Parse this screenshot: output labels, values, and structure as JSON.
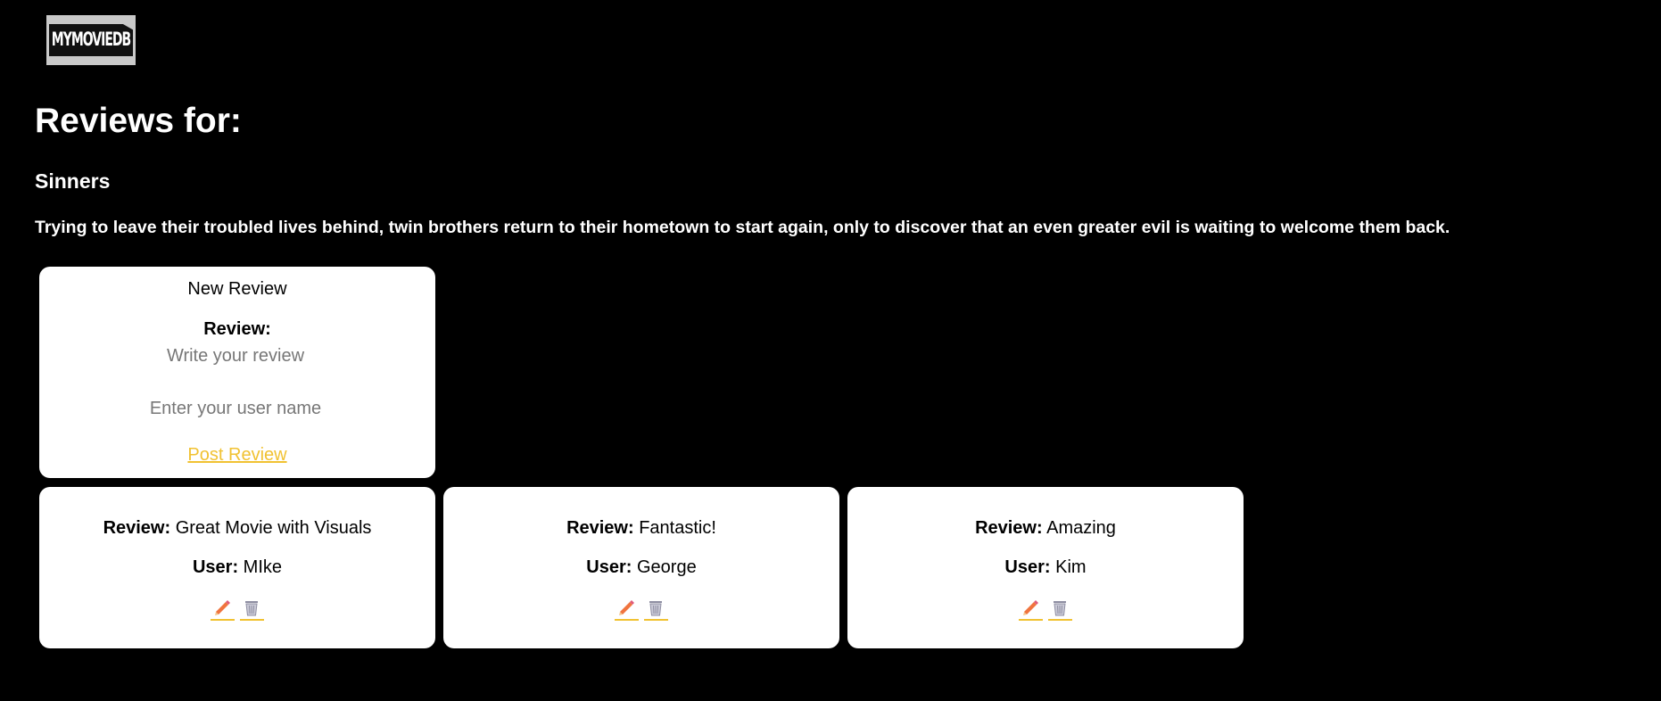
{
  "logo": {
    "text": "MYMOVIEDB"
  },
  "header": {
    "heading": "Reviews for:"
  },
  "movie": {
    "title": "Sinners",
    "overview": "Trying to leave their troubled lives behind, twin brothers return to their hometown to start again, only to discover that an even greater evil is waiting to welcome them back."
  },
  "new_review": {
    "title": "New Review",
    "review_label": "Review:",
    "review_placeholder": "Write your review",
    "user_placeholder": "Enter your user name",
    "post_label": "Post Review"
  },
  "labels": {
    "review": "Review:",
    "user": "User:"
  },
  "reviews": [
    {
      "text": "Great Movie with Visuals",
      "user": "MIke"
    },
    {
      "text": "Fantastic!",
      "user": "George"
    },
    {
      "text": "Amazing",
      "user": "Kim"
    }
  ],
  "colors": {
    "background": "#000000",
    "card": "#ffffff",
    "accent_link": "#f1c232",
    "placeholder": "#777777"
  },
  "icons": {
    "edit": "pencil-icon",
    "delete": "trash-icon"
  }
}
